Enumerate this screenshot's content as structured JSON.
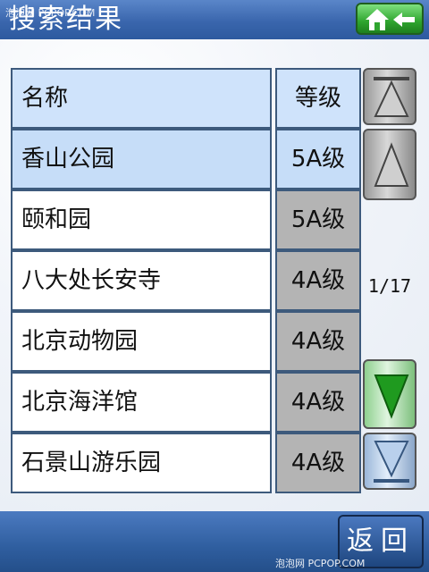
{
  "header": {
    "title": "搜索结果",
    "home_icon": "home-back-icon"
  },
  "table": {
    "columns": [
      "名称",
      "等级"
    ],
    "rows": [
      {
        "name": "香山公园",
        "grade": "5A级",
        "selected": true
      },
      {
        "name": "颐和园",
        "grade": "5A级",
        "selected": false
      },
      {
        "name": "八大处长安寺",
        "grade": "4A级",
        "selected": false
      },
      {
        "name": "北京动物园",
        "grade": "4A级",
        "selected": false
      },
      {
        "name": "北京海洋馆",
        "grade": "4A级",
        "selected": false
      },
      {
        "name": "石景山游乐园",
        "grade": "4A级",
        "selected": false
      }
    ]
  },
  "scroll": {
    "page_indicator": "1/17"
  },
  "footer": {
    "back_label": "返回"
  },
  "watermarks": {
    "top": "泡泡网 PCPOP.COM",
    "bottom": "泡泡网 PCPOP.COM"
  },
  "colors": {
    "header": "#3a66ad",
    "selected_row": "#c6ddf8",
    "grade_cell": "#b4b4b4",
    "home_button": "#2fa52f"
  }
}
